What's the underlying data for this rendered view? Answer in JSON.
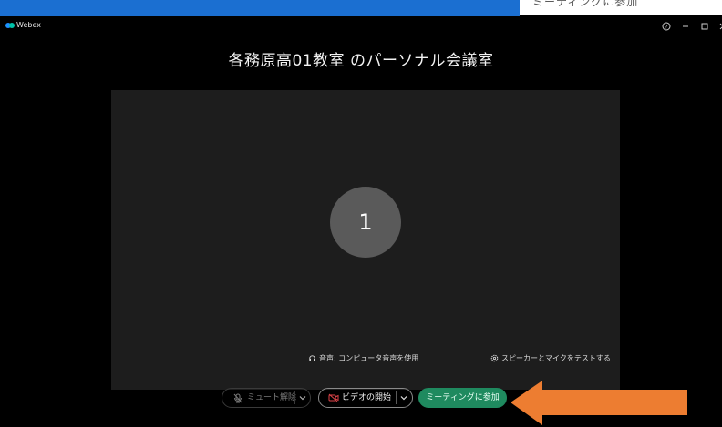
{
  "background": {
    "partial_text": "ミーティングに参加"
  },
  "window": {
    "app_title": "Webex",
    "meeting_title": "各務原高01教室 のパーソナル会議室",
    "avatar_initial": "1",
    "audio_status": "音声: コンピュータ音声を使用",
    "test_link": "スピーカーとマイクをテストする"
  },
  "controls": {
    "mute_label": "ミュート解除",
    "video_label": "ビデオの開始",
    "join_label": "ミーティングに参加"
  },
  "colors": {
    "join_button": "#1f8a5f",
    "annotation_arrow": "#ed7d31",
    "preview_bg": "#1d1d1d",
    "avatar_bg": "#5a5a5a",
    "video_off_icon": "#e0454a"
  }
}
